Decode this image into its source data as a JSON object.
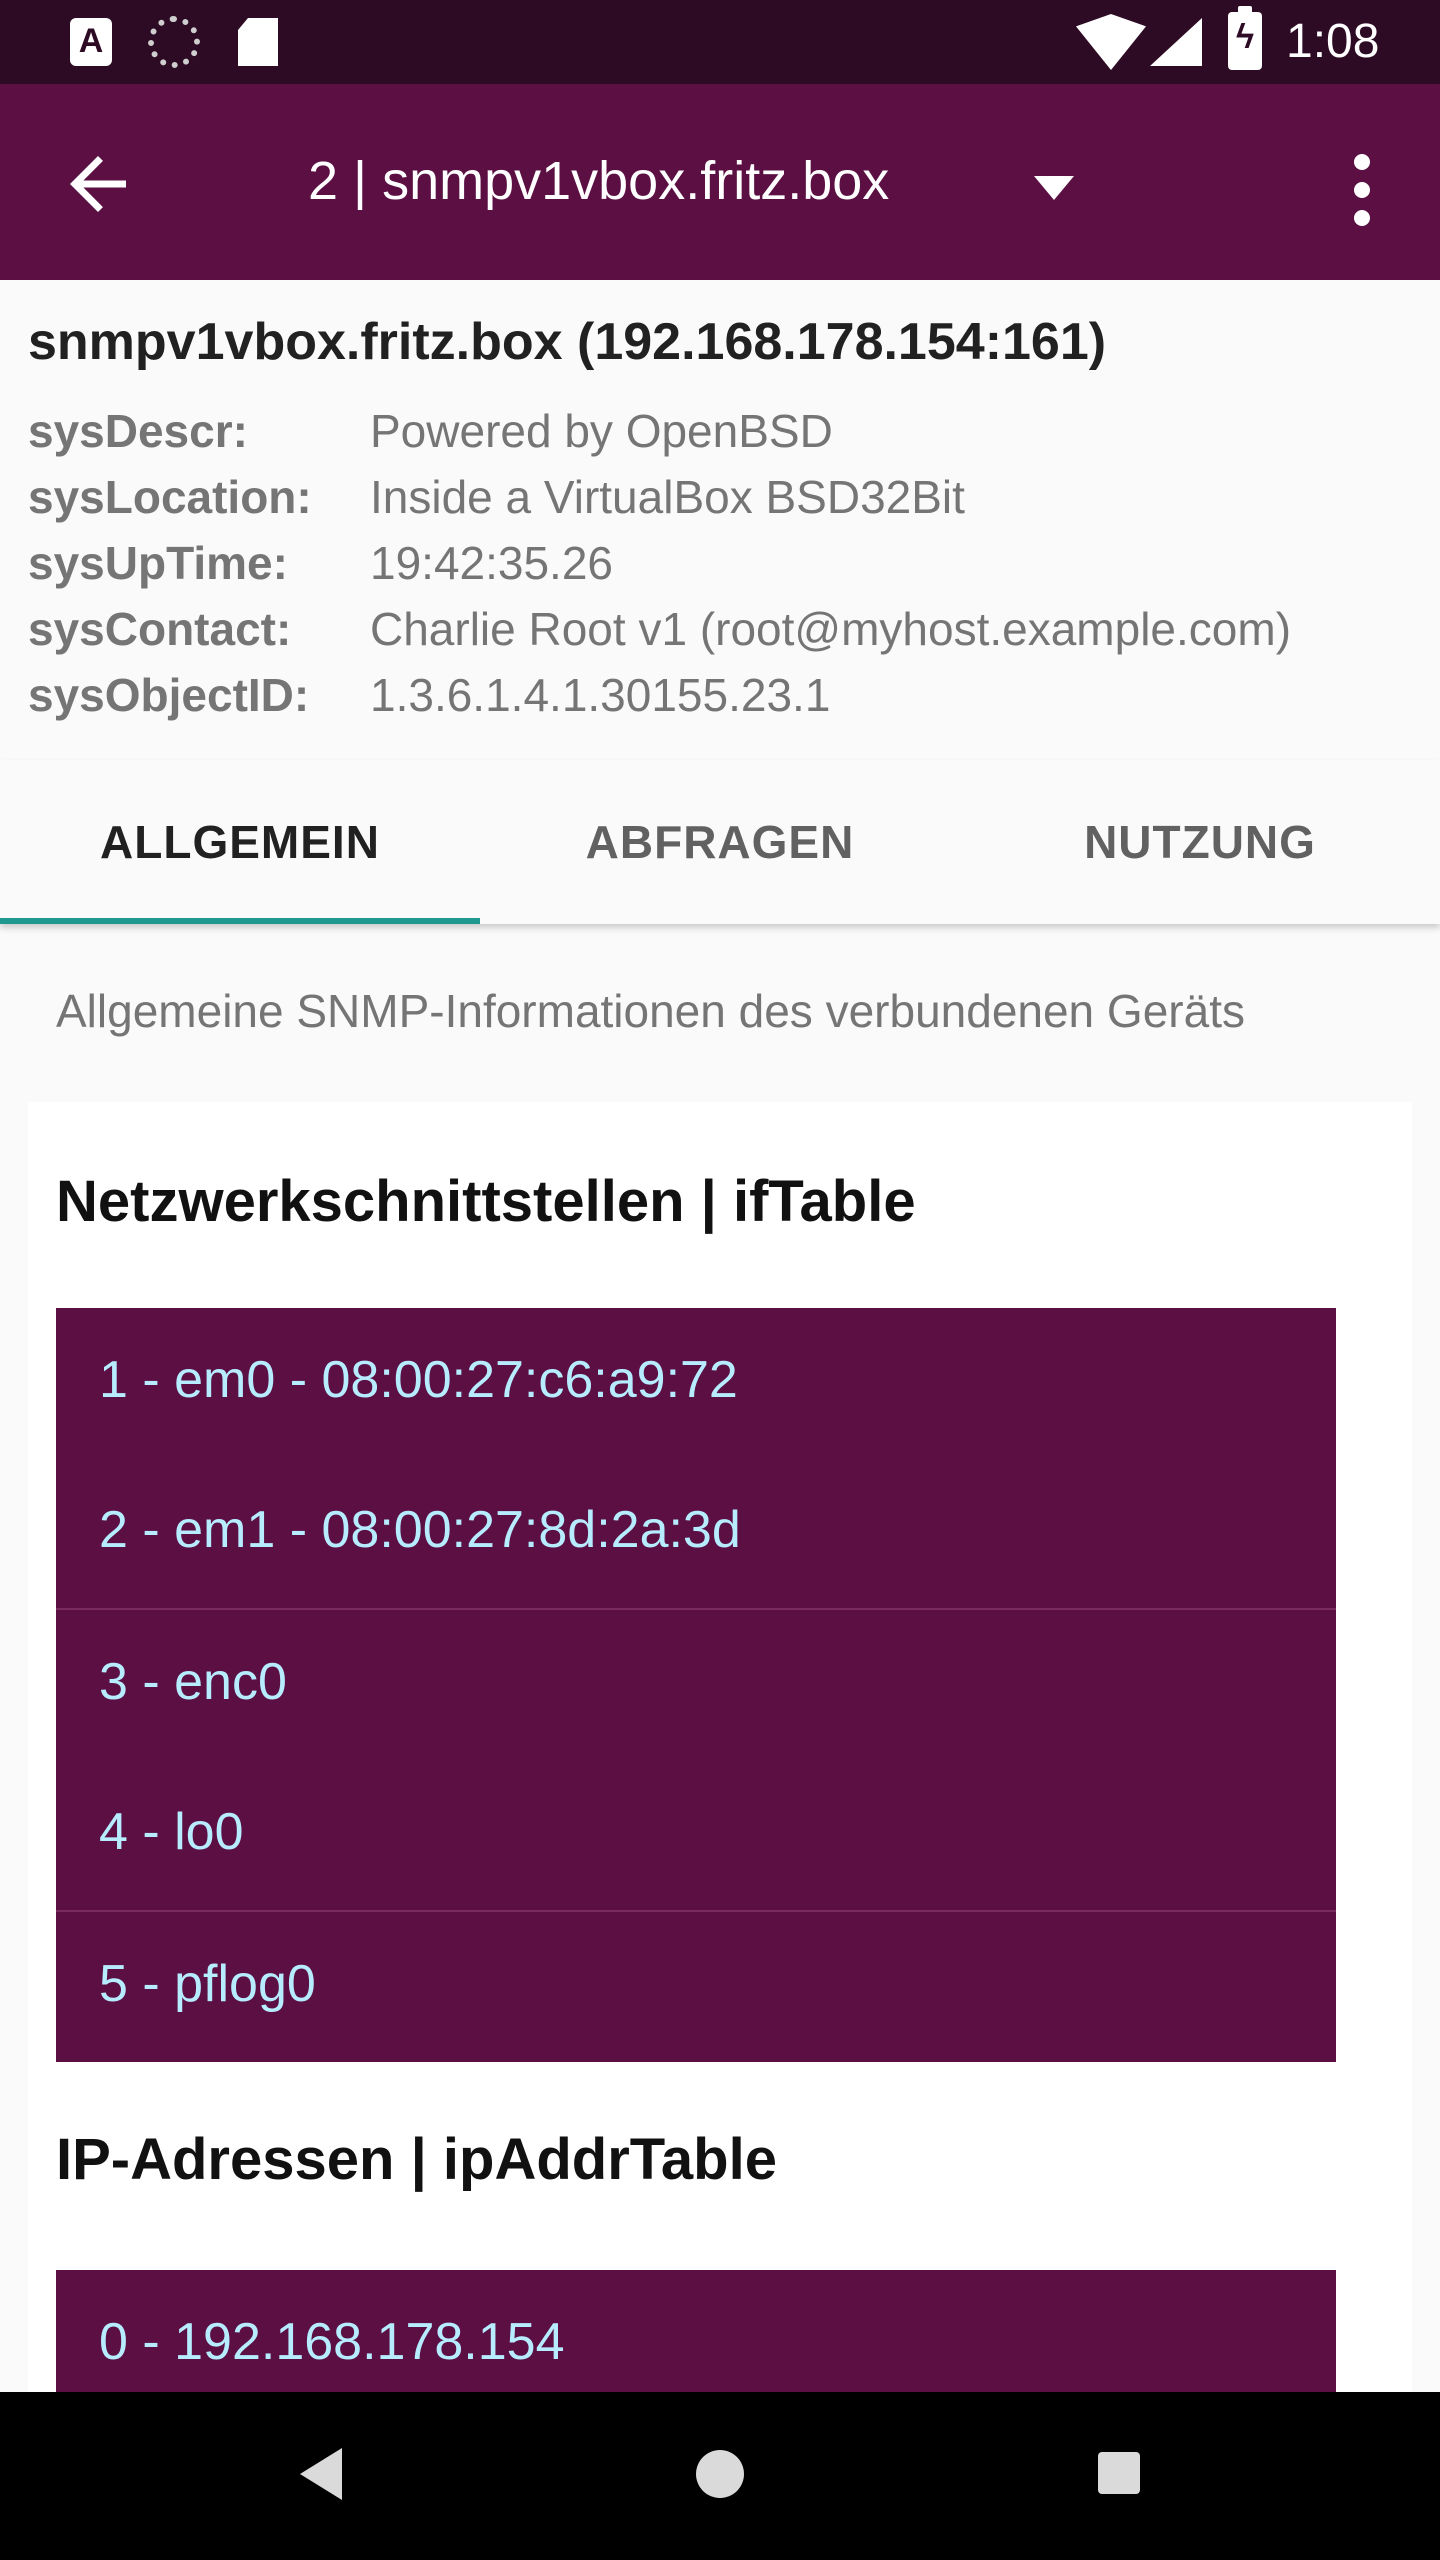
{
  "status_bar": {
    "time": "1:08",
    "icons": [
      "text-app-icon",
      "loading-icon",
      "sd-card-icon",
      "wifi-icon",
      "signal-icon",
      "battery-charging-icon"
    ],
    "battery_glyph": "ϟ",
    "text_app_glyph": "A"
  },
  "app_bar": {
    "title": "2 | snmpv1vbox.fritz.box",
    "back_icon": "arrow-back-icon",
    "dropdown_icon": "dropdown-arrow-icon",
    "overflow_icon": "more-vert-icon",
    "background": "#5b0f43"
  },
  "device": {
    "header": "snmpv1vbox.fritz.box (192.168.178.154:161)",
    "fields": [
      {
        "key": "sysDescr:",
        "value": "Powered by OpenBSD"
      },
      {
        "key": "sysLocation:",
        "value": "Inside a VirtualBox BSD32Bit"
      },
      {
        "key": "sysUpTime:",
        "value": "19:42:35.26"
      },
      {
        "key": "sysContact:",
        "value": "Charlie Root v1 (root@myhost.example.com)"
      },
      {
        "key": "sysObjectID:",
        "value": "1.3.6.1.4.1.30155.23.1"
      }
    ]
  },
  "tabs": [
    {
      "label": "ALLGEMEIN",
      "selected": true
    },
    {
      "label": "ABFRAGEN",
      "selected": false
    },
    {
      "label": "NUTZUNG",
      "selected": false
    }
  ],
  "accent_color": "#20978f",
  "general": {
    "description": "Allgemeine SNMP-Informationen des verbundenen Geräts",
    "interfaces": {
      "title": "Netzwerkschnittstellen | ifTable",
      "items": [
        "1 - em0 - 08:00:27:c6:a9:72",
        "2 - em1 - 08:00:27:8d:2a:3d",
        "3 - enc0",
        "4 - lo0",
        "5 - pflog0"
      ]
    },
    "ip_addresses": {
      "title": "IP-Adressen | ipAddrTable",
      "items": [
        "0 - 192.168.178.154"
      ]
    }
  },
  "nav_bar": {
    "icons": [
      "nav-back-icon",
      "nav-home-icon",
      "nav-recents-icon"
    ]
  }
}
